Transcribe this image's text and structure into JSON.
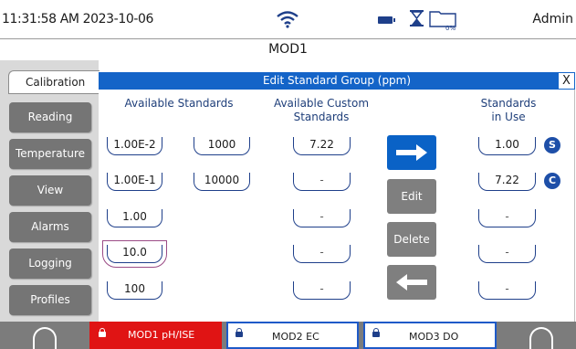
{
  "status": {
    "time": "11:31:58 AM 2023-10-06",
    "storage_percent": "0%",
    "user": "Admin"
  },
  "module_title": "MOD1",
  "sidebar": {
    "active_tab": "Calibration",
    "items": [
      "Reading",
      "Temperature",
      "View",
      "Alarms",
      "Logging",
      "Profiles"
    ]
  },
  "dialog": {
    "title": "Edit Standard Group (ppm)",
    "close_label": "X",
    "available_header": "Available Standards",
    "custom_header_line1": "Available Custom",
    "custom_header_line2": "Standards",
    "in_use_header_line1": "Standards",
    "in_use_header_line2": "in Use",
    "available_col1": [
      "1.00E-2",
      "1.00E-1",
      "1.00",
      "10.0",
      "100"
    ],
    "available_col2": [
      "1000",
      "10000"
    ],
    "custom": [
      "7.22",
      "-",
      "-",
      "-",
      "-"
    ],
    "in_use": [
      "1.00",
      "7.22",
      "-",
      "-",
      "-"
    ],
    "in_use_badges": [
      "S",
      "C"
    ],
    "selected_standard": "10.0",
    "edit_label": "Edit",
    "delete_label": "Delete"
  },
  "bottom_bar": {
    "tabs": [
      "MOD1 pH/ISE",
      "MOD2 EC",
      "MOD3 DO"
    ],
    "active_tab_color": "#e01414",
    "accent": "#1464c8"
  }
}
